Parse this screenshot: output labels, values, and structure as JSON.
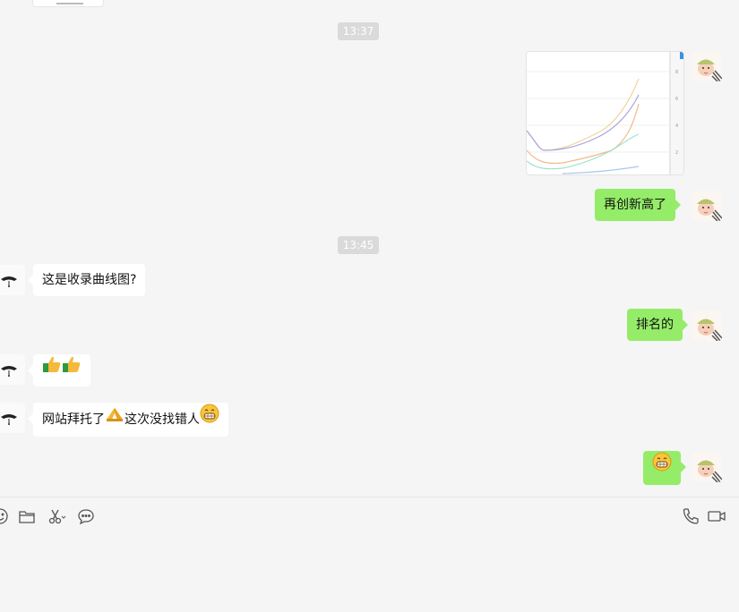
{
  "chat": {
    "timestamps": [
      "13:37",
      "13:45"
    ],
    "messages": [
      {
        "text": "再创新高了"
      },
      {
        "text": "这是收录曲线图?"
      },
      {
        "text": "排名的"
      },
      {
        "text": "网站拜托了",
        "text2": "这次没找错人"
      }
    ]
  },
  "icons": {
    "thumbs_up": "thumbs-up-icon",
    "pray": "pray-hands-icon",
    "grin": "grinning-face-icon"
  },
  "colors": {
    "background": "#f5f5f5",
    "out_bubble": "#95ec69",
    "in_bubble": "#ffffff",
    "timestamp_bg": "#dadada"
  }
}
